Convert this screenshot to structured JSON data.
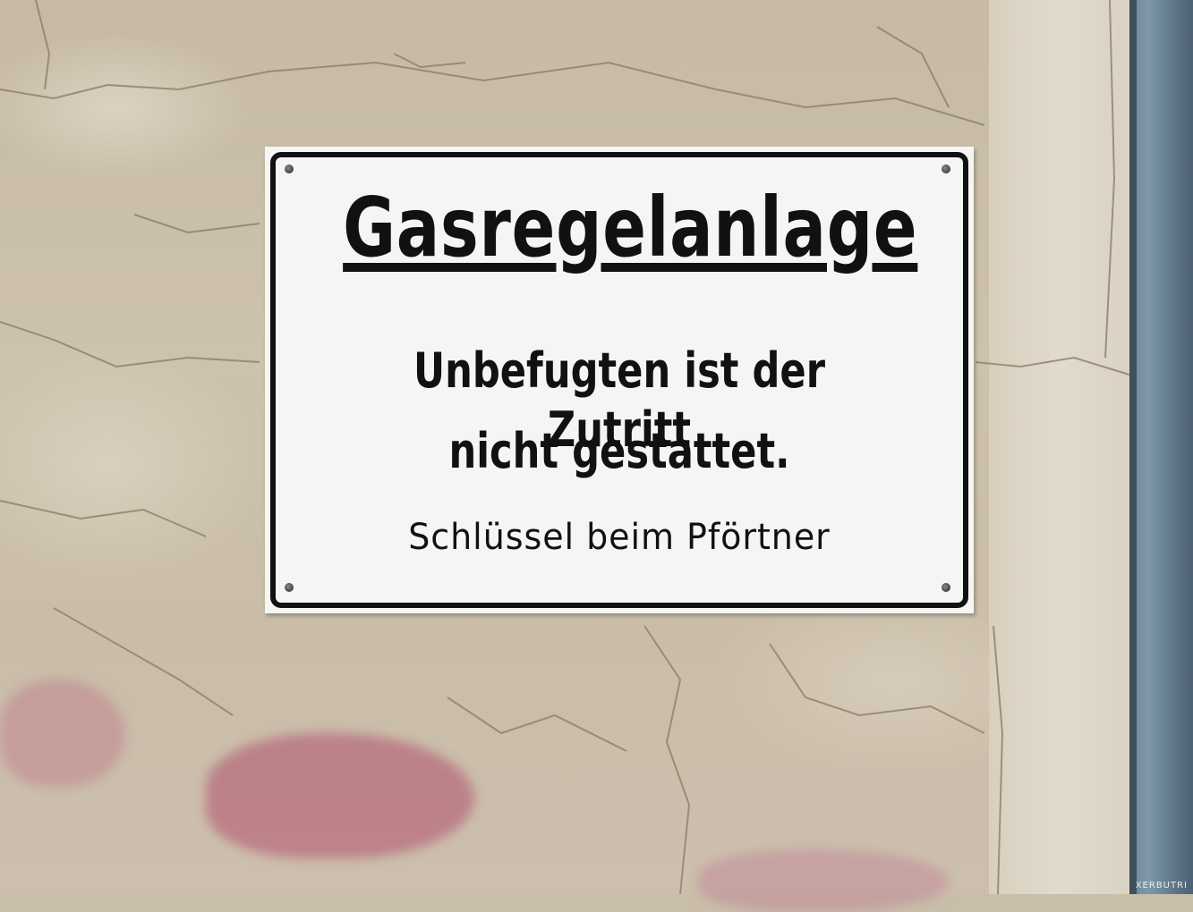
{
  "sign": {
    "title": "Gasregelanlage",
    "line1": "Unbefugten ist der Zutritt",
    "line2": "nicht gestattet.",
    "line3": "Schlüssel beim Pförtner"
  },
  "watermark": "XERBUTRI",
  "colors": {
    "wall": "#c9beaa",
    "sign_background": "#f5f6f4",
    "sign_text": "#111111",
    "post": "#6a8497",
    "stain": "#b0506e"
  }
}
